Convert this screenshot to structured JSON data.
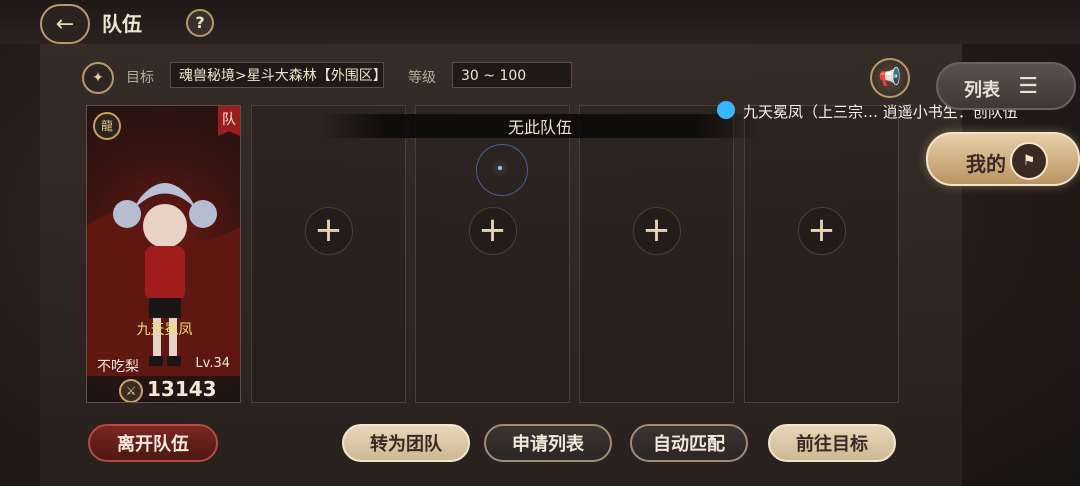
{
  "header": {
    "title": "队伍",
    "help_label": "?"
  },
  "filter": {
    "target_label": "目标",
    "target_value": "魂兽秘境>星斗大森林【外围区】",
    "level_label": "等级",
    "level_value": "30 ~ 100"
  },
  "team": {
    "status_banner": "无此队伍",
    "badge": "队",
    "member": {
      "character_name": "九天冕凤",
      "player_name": "不吃梨",
      "level": "Lv.34",
      "power": "13143"
    },
    "empty_slot_plus": "+"
  },
  "chat": {
    "message": "九天冕凤（上三宗… 逍遥小书生：创队伍"
  },
  "side": {
    "list_label": "列表",
    "mine_label": "我的"
  },
  "actions": {
    "leave": "离开队伍",
    "convert": "转为团队",
    "apply_list": "申请列表",
    "auto_match": "自动匹配",
    "go_target": "前往目标"
  },
  "icons": {
    "back": "back-arrow-icon",
    "help": "question-icon",
    "target": "target-compass-icon",
    "speaker": "megaphone-icon",
    "list": "list-icon",
    "mine": "flag-icon",
    "power": "power-icon",
    "chat": "qq-icon"
  },
  "colors": {
    "accent_gold": "#e7d0a8",
    "danger": "#7a2722",
    "name_yellow": "#f2df6f"
  }
}
